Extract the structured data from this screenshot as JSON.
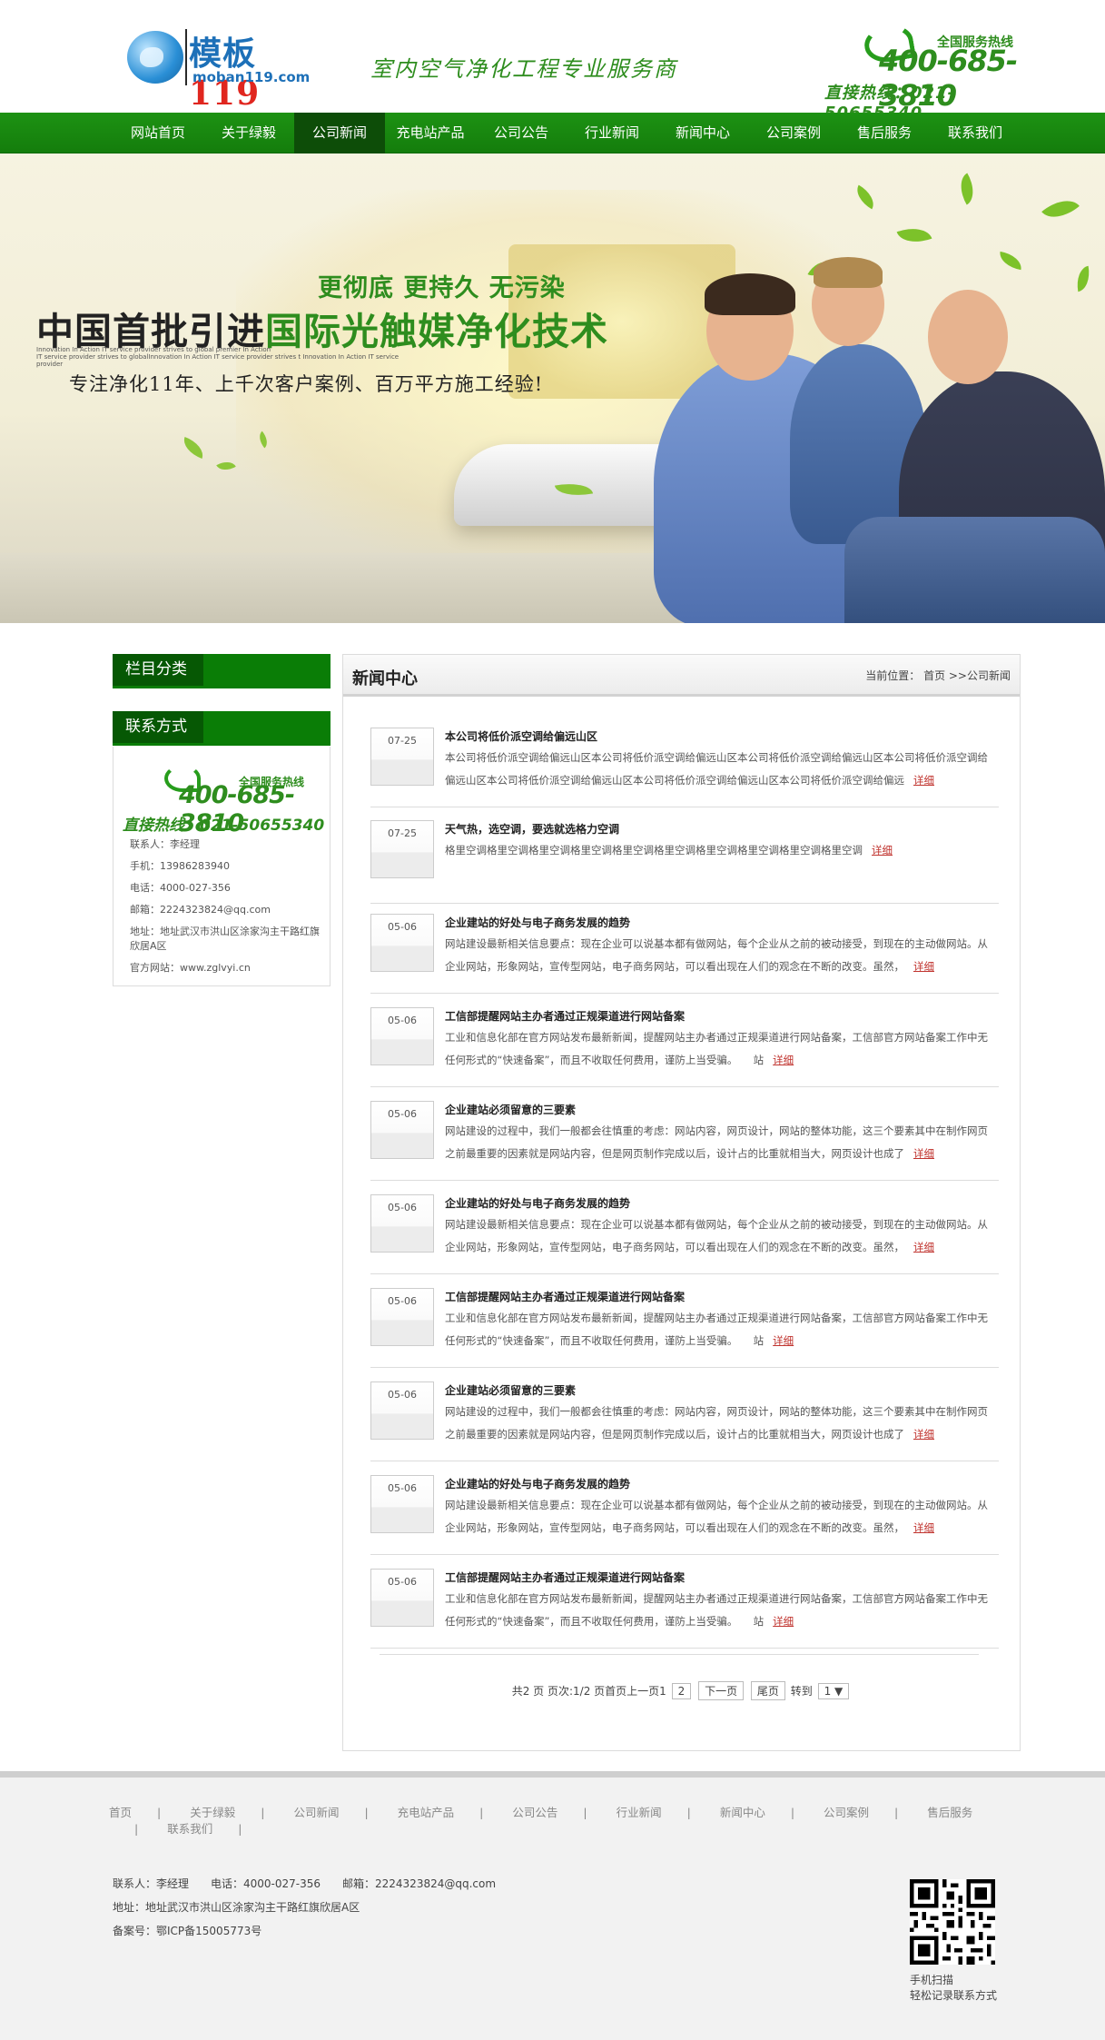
{
  "header": {
    "logo_text": "模板",
    "logo_num": "119",
    "logo_domain": "moban119.com",
    "slogan": "室内空气净化工程专业服务商",
    "hotline_label": "全国服务热线",
    "hotline_num": "400-685-3810",
    "direct_line": "直接热线：021-50655340"
  },
  "nav": [
    {
      "label": "网站首页"
    },
    {
      "label": "关于绿毅"
    },
    {
      "label": "公司新闻",
      "active": true
    },
    {
      "label": "充电站产品"
    },
    {
      "label": "公司公告"
    },
    {
      "label": "行业新闻"
    },
    {
      "label": "新闻中心"
    },
    {
      "label": "公司案例"
    },
    {
      "label": "售后服务"
    },
    {
      "label": "联系我们"
    }
  ],
  "banner": {
    "tagline": "更彻底 更持久 无污染",
    "headline_a": "中国首批引进",
    "headline_b": "国际光触媒净化技术",
    "small_lines": [
      "Innovation In Action IT service provider strives to global premier In Action",
      "IT service provider strives to globalInnovation In Action IT service provider strives t Innovation In Action IT service provider"
    ],
    "subline": "专注净化11年、上千次客户案例、百万平方施工经验!"
  },
  "sidebar": {
    "category_title": "栏目分类",
    "contact_title": "联系方式",
    "hotline_label": "全国服务热线",
    "hotline_num": "400-685-3810",
    "direct_line": "直接热线：021-50655340",
    "lines": [
      "联系人：李经理",
      "手机：13986283940",
      "电话：4000-027-356",
      "邮箱：2224323824@qq.com",
      "地址：地址武汉市洪山区涂家沟主干路红旗欣居A区",
      "官方网站：www.zglvyi.cn"
    ]
  },
  "main": {
    "title": "新闻中心",
    "breadcrumb": "当前位置： 首页 >>公司新闻",
    "more": "详细",
    "items": [
      {
        "date": "07-25",
        "title": "本公司将低价派空调给偏远山区",
        "desc": "本公司将低价派空调给偏远山区本公司将低价派空调给偏远山区本公司将低价派空调给偏远山区本公司将低价派空调给偏远山区本公司将低价派空调给偏远山区本公司将低价派空调给偏远山区本公司将低价派空调给偏远"
      },
      {
        "date": "07-25",
        "title": "天气热，选空调，要选就选格力空调",
        "desc": "格里空调格里空调格里空调格里空调格里空调格里空调格里空调格里空调格里空调格里空调"
      },
      {
        "date": "05-06",
        "title": "企业建站的好处与电子商务发展的趋势",
        "desc": "网站建设最新相关信息要点：现在企业可以说基本都有做网站，每个企业从之前的被动接受，到现在的主动做网站。从企业网站，形象网站，宣传型网站，电子商务网站，可以看出现在人们的观念在不断的改变。虽然，"
      },
      {
        "date": "05-06",
        "title": "工信部提醒网站主办者通过正规渠道进行网站备案",
        "desc": "工业和信息化部在官方网站发布最新新闻，提醒网站主办者通过正规渠道进行网站备案，工信部官方网站备案工作中无任何形式的“快速备案”，而且不收取任何费用，谨防上当受骗。　　站"
      },
      {
        "date": "05-06",
        "title": "企业建站必须留意的三要素",
        "desc": "网站建设的过程中，我们一般都会往慎重的考虑：网站内容，网页设计，网站的整体功能，这三个要素其中在制作网页之前最重要的因素就是网站内容，但是网页制作完成以后，设计占的比重就相当大，网页设计也成了"
      },
      {
        "date": "05-06",
        "title": "企业建站的好处与电子商务发展的趋势",
        "desc": "网站建设最新相关信息要点：现在企业可以说基本都有做网站，每个企业从之前的被动接受，到现在的主动做网站。从企业网站，形象网站，宣传型网站，电子商务网站，可以看出现在人们的观念在不断的改变。虽然，"
      },
      {
        "date": "05-06",
        "title": "工信部提醒网站主办者通过正规渠道进行网站备案",
        "desc": "工业和信息化部在官方网站发布最新新闻，提醒网站主办者通过正规渠道进行网站备案，工信部官方网站备案工作中无任何形式的“快速备案”，而且不收取任何费用，谨防上当受骗。　　站"
      },
      {
        "date": "05-06",
        "title": "企业建站必须留意的三要素",
        "desc": "网站建设的过程中，我们一般都会往慎重的考虑：网站内容，网页设计，网站的整体功能，这三个要素其中在制作网页之前最重要的因素就是网站内容，但是网页制作完成以后，设计占的比重就相当大，网页设计也成了"
      },
      {
        "date": "05-06",
        "title": "企业建站的好处与电子商务发展的趋势",
        "desc": "网站建设最新相关信息要点：现在企业可以说基本都有做网站，每个企业从之前的被动接受，到现在的主动做网站。从企业网站，形象网站，宣传型网站，电子商务网站，可以看出现在人们的观念在不断的改变。虽然，"
      },
      {
        "date": "05-06",
        "title": "工信部提醒网站主办者通过正规渠道进行网站备案",
        "desc": "工业和信息化部在官方网站发布最新新闻，提醒网站主办者通过正规渠道进行网站备案，工信部官方网站备案工作中无任何形式的“快速备案”，而且不收取任何费用，谨防上当受骗。　　站"
      }
    ],
    "pager": {
      "summary": "共2 页 页次:1/2 页首页上一页1",
      "page2": "2",
      "next": "下一页",
      "last": "尾页",
      "goto": "转到",
      "select": "1 ▼"
    }
  },
  "footer": {
    "links": [
      "首页",
      "关于绿毅",
      "公司新闻",
      "充电站产品",
      "公司公告",
      "行业新闻",
      "新闻中心",
      "公司案例",
      "售后服务",
      "联系我们"
    ],
    "info1": "联系人：李经理　　电话：4000-027-356　　邮箱：2224323824@qq.com",
    "info2": "地址：地址武汉市洪山区涂家沟主干路红旗欣居A区",
    "info3": "备案号：鄂ICP备15005773号",
    "qr_line1": "手机扫描",
    "qr_line2": "轻松记录联系方式"
  },
  "colors": {
    "brand_green": "#1a8a12",
    "dark_green": "#0d4d08",
    "link_red": "#c0332e"
  }
}
